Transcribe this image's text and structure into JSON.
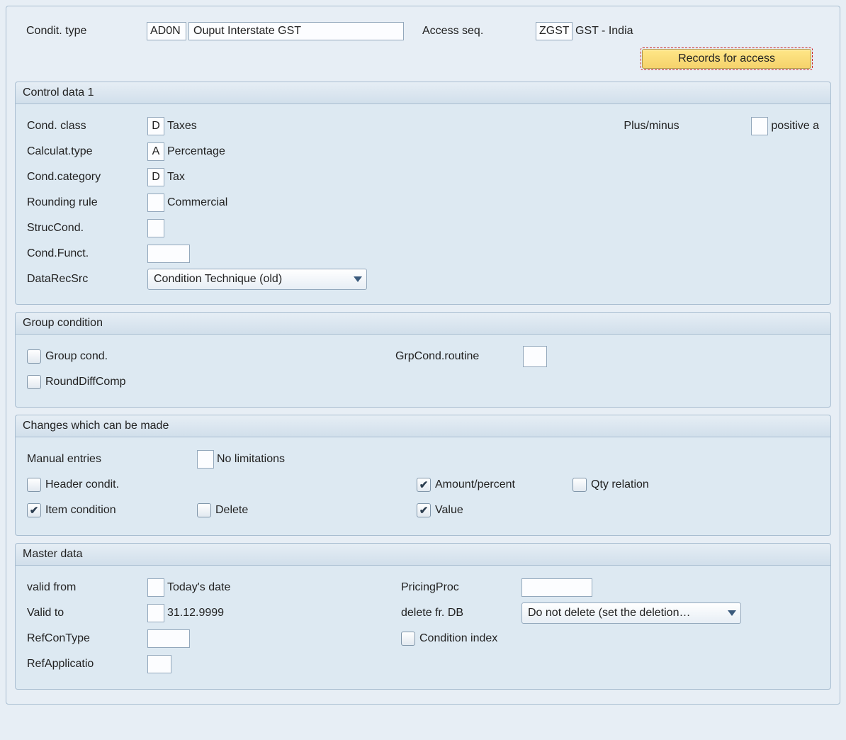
{
  "header": {
    "conditTypeLabel": "Condit. type",
    "conditTypeCode": "AD0N",
    "conditTypeDesc": "Ouput Interstate GST",
    "accessSeqLabel": "Access seq.",
    "accessSeqCode": "ZGST",
    "accessSeqDesc": "GST - India",
    "recordsButton": "Records for access"
  },
  "control1": {
    "title": "Control data 1",
    "condClassLabel": "Cond. class",
    "condClassCode": "D",
    "condClassText": "Taxes",
    "plusMinusLabel": "Plus/minus",
    "plusMinusText": "positive a",
    "calcTypeLabel": "Calculat.type",
    "calcTypeCode": "A",
    "calcTypeText": "Percentage",
    "condCatLabel": "Cond.category",
    "condCatCode": "D",
    "condCatText": "Tax",
    "roundingLabel": "Rounding rule",
    "roundingText": "Commercial",
    "strucLabel": "StrucCond.",
    "funcLabel": "Cond.Funct.",
    "dataRecLabel": "DataRecSrc",
    "dataRecSel": "Condition Technique (old)"
  },
  "group": {
    "title": "Group condition",
    "groupCondLabel": "Group cond.",
    "grpRoutineLabel": "GrpCond.routine",
    "roundDiffLabel": "RoundDiffComp"
  },
  "changes": {
    "title": "Changes which can be made",
    "manualLabel": "Manual entries",
    "manualText": "No limitations",
    "headerCondLabel": "Header condit.",
    "amountLabel": "Amount/percent",
    "qtyLabel": "Qty relation",
    "itemCondLabel": "Item condition",
    "deleteLabel": "Delete",
    "valueLabel": "Value"
  },
  "master": {
    "title": "Master data",
    "validFromLabel": "valid from",
    "validFromText": "Today's date",
    "pricingProcLabel": "PricingProc",
    "validToLabel": "Valid to",
    "validToText": "31.12.9999",
    "deleteDbLabel": "delete fr. DB",
    "deleteDbSel": "Do not delete (set the deletion…",
    "refConTypeLabel": "RefConType",
    "condIndexLabel": "Condition index",
    "refAppLabel": "RefApplicatio"
  }
}
